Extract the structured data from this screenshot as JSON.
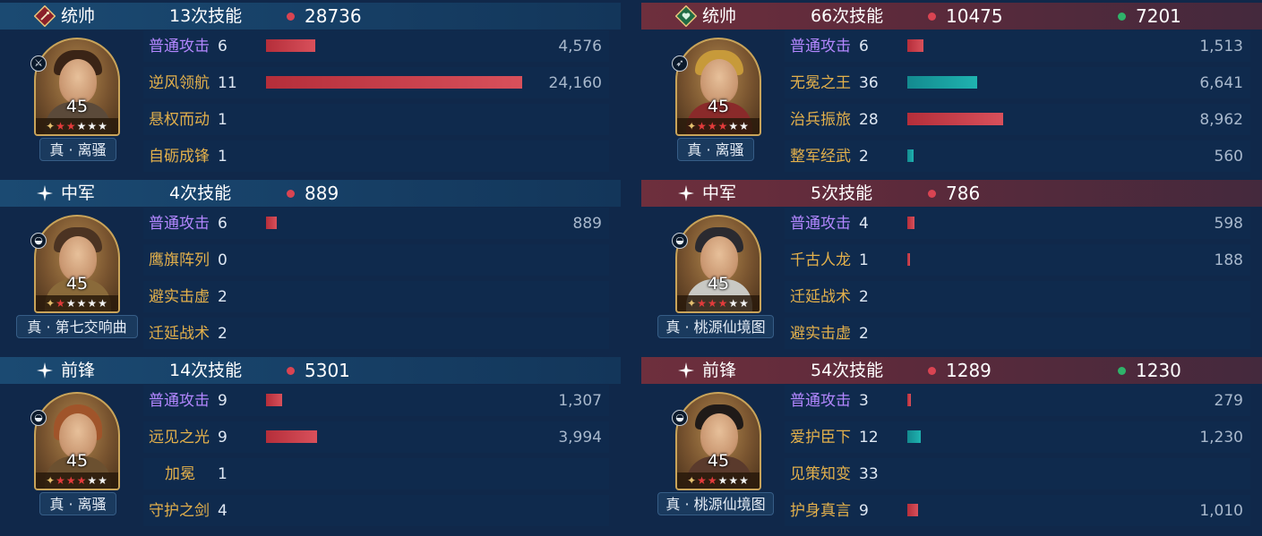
{
  "colors": {
    "red_bar": "#d8505b",
    "teal_bar": "#1fb3b0",
    "basic_attack": "#b387ff",
    "skill": "#e3b04b"
  },
  "left": {
    "sections": [
      {
        "role": "统帅",
        "role_icon": "sword-diamond-icon",
        "skill_count": "13次技能",
        "red_total": "28736",
        "level": "45",
        "stars": 6,
        "red_stars": 2,
        "title": "真 · 离骚",
        "weapon_icon": "sword-icon",
        "skills": [
          {
            "name": "普通攻击",
            "basic": true,
            "count": "6",
            "bar_type": "red",
            "fill_pct": 10.5,
            "value": "4,576"
          },
          {
            "name": "逆风领航",
            "basic": false,
            "count": "11",
            "bar_type": "red",
            "fill_pct": 55.0,
            "value": "24,160"
          },
          {
            "name": "悬权而动",
            "basic": false,
            "count": "1",
            "bar_type": "",
            "fill_pct": 0,
            "value": ""
          },
          {
            "name": "自砺成锋",
            "basic": false,
            "count": "1",
            "bar_type": "",
            "fill_pct": 0,
            "value": ""
          }
        ]
      },
      {
        "role": "中军",
        "role_icon": "sparkle-icon",
        "skill_count": "4次技能",
        "red_total": "889",
        "level": "45",
        "stars": 6,
        "red_stars": 1,
        "title": "真 · 第七交响曲",
        "weapon_icon": "shield-icon",
        "skills": [
          {
            "name": "普通攻击",
            "basic": true,
            "count": "6",
            "bar_type": "red",
            "fill_pct": 2.3,
            "value": "889"
          },
          {
            "name": "鹰旗阵列",
            "basic": false,
            "count": "0",
            "bar_type": "",
            "fill_pct": 0,
            "value": ""
          },
          {
            "name": "避实击虚",
            "basic": false,
            "count": "2",
            "bar_type": "",
            "fill_pct": 0,
            "value": ""
          },
          {
            "name": "迁延战术",
            "basic": false,
            "count": "2",
            "bar_type": "",
            "fill_pct": 0,
            "value": ""
          }
        ]
      },
      {
        "role": "前锋",
        "role_icon": "sparkle-icon",
        "skill_count": "14次技能",
        "red_total": "5301",
        "level": "45",
        "stars": 6,
        "red_stars": 3,
        "title": "真 · 离骚",
        "weapon_icon": "shield-icon",
        "skills": [
          {
            "name": "普通攻击",
            "basic": true,
            "count": "9",
            "bar_type": "red",
            "fill_pct": 3.5,
            "value": "1,307"
          },
          {
            "name": "远见之光",
            "basic": false,
            "count": "9",
            "bar_type": "red",
            "fill_pct": 11.0,
            "value": "3,994"
          },
          {
            "name": "加冕",
            "basic": false,
            "count": "1",
            "bar_type": "",
            "fill_pct": 0,
            "value": ""
          },
          {
            "name": "守护之剑",
            "basic": false,
            "count": "4",
            "bar_type": "",
            "fill_pct": 0,
            "value": ""
          }
        ]
      }
    ]
  },
  "right": {
    "sections": [
      {
        "role": "统帅",
        "role_icon": "heart-diamond-icon",
        "skill_count": "66次技能",
        "red_total": "10475",
        "green_total": "7201",
        "level": "45",
        "stars": 6,
        "red_stars": 3,
        "title": "真 · 离骚",
        "weapon_icon": "bow-icon",
        "skills": [
          {
            "name": "普通攻击",
            "basic": true,
            "count": "6",
            "bar_type": "red",
            "fill_pct": 3.5,
            "value": "1,513"
          },
          {
            "name": "无冕之王",
            "basic": false,
            "count": "36",
            "bar_type": "teal",
            "fill_pct": 15.0,
            "value": "6,641"
          },
          {
            "name": "治兵振旅",
            "basic": false,
            "count": "28",
            "bar_type": "red",
            "fill_pct": 20.5,
            "value": "8,962"
          },
          {
            "name": "整军经武",
            "basic": false,
            "count": "2",
            "bar_type": "teal",
            "fill_pct": 1.3,
            "value": "560"
          }
        ]
      },
      {
        "role": "中军",
        "role_icon": "sparkle-icon",
        "skill_count": "5次技能",
        "red_total": "786",
        "level": "45",
        "stars": 6,
        "red_stars": 3,
        "title": "真 · 桃源仙境图",
        "weapon_icon": "shield-icon",
        "skills": [
          {
            "name": "普通攻击",
            "basic": true,
            "count": "4",
            "bar_type": "red",
            "fill_pct": 1.5,
            "value": "598"
          },
          {
            "name": "千古人龙",
            "basic": false,
            "count": "1",
            "bar_type": "red",
            "fill_pct": 0.5,
            "value": "188"
          },
          {
            "name": "迁延战术",
            "basic": false,
            "count": "2",
            "bar_type": "",
            "fill_pct": 0,
            "value": ""
          },
          {
            "name": "避实击虚",
            "basic": false,
            "count": "2",
            "bar_type": "",
            "fill_pct": 0,
            "value": ""
          }
        ]
      },
      {
        "role": "前锋",
        "role_icon": "sparkle-icon",
        "skill_count": "54次技能",
        "red_total": "1289",
        "green_total": "1230",
        "level": "45",
        "stars": 6,
        "red_stars": 2,
        "title": "真 · 桃源仙境图",
        "weapon_icon": "shield-icon",
        "skills": [
          {
            "name": "普通攻击",
            "basic": true,
            "count": "3",
            "bar_type": "red",
            "fill_pct": 0.7,
            "value": "279"
          },
          {
            "name": "爱护臣下",
            "basic": false,
            "count": "12",
            "bar_type": "teal",
            "fill_pct": 2.8,
            "value": "1,230"
          },
          {
            "name": "见策知变",
            "basic": false,
            "count": "33",
            "bar_type": "",
            "fill_pct": 0,
            "value": ""
          },
          {
            "name": "护身真言",
            "basic": false,
            "count": "9",
            "bar_type": "red",
            "fill_pct": 2.4,
            "value": "1,010"
          }
        ]
      }
    ]
  }
}
